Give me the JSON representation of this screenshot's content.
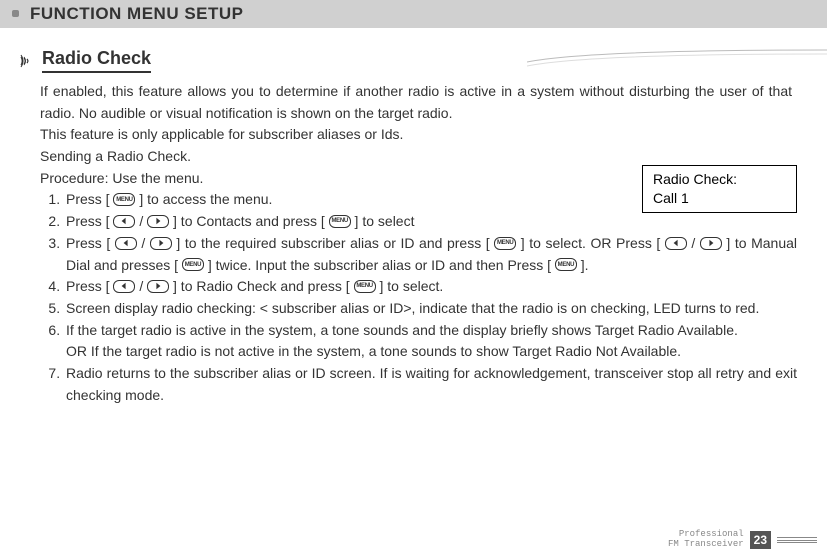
{
  "header": {
    "title": "FUNCTION MENU SETUP"
  },
  "section": {
    "subtitle": "Radio Check",
    "intro1": "If enabled, this feature allows you to determine if another radio is active in a system without disturbing the user of that radio. No audible or visual notification is shown on the target radio.",
    "intro2": "This feature is only applicable for subscriber aliases or Ids.",
    "intro3": "Sending a Radio Check.",
    "intro4": "Procedure: Use the menu."
  },
  "steps": {
    "s1a": "Press [ ",
    "s1b": " ] to access the menu.",
    "s2a": "Press [ ",
    "s2b": " / ",
    "s2c": " ] to Contacts and press [ ",
    "s2d": " ] to select",
    "s3a": "Press [ ",
    "s3b": " / ",
    "s3c": " ] to the required subscriber alias or ID and press [ ",
    "s3d": " ] to select. OR Press  [ ",
    "s3e": " / ",
    "s3f": " ]  to Manual Dial and presses [ ",
    "s3g": " ] twice. Input the subscriber alias or ID and then Press [ ",
    "s3h": " ].",
    "s4a": "Press [ ",
    "s4b": " / ",
    "s4c": " ] to Radio Check and press [ ",
    "s4d": " ] to select.",
    "s5": "Screen display radio checking: < subscriber alias or ID>, indicate that the radio is on checking, LED turns to red.",
    "s6a": "If the target radio is active in the system, a tone sounds and the display briefly shows Target Radio Available.",
    "s6b": "OR If the target radio is not active in the system, a tone sounds to show Target Radio Not Available.",
    "s7": "Radio returns to the subscriber alias or ID screen. If is waiting for acknowledgement, transceiver stop all retry and exit checking mode."
  },
  "callout": {
    "line1": "Radio Check:",
    "line2": "Call 1"
  },
  "buttons": {
    "menu": "MENU"
  },
  "footer": {
    "line1": "Professional",
    "line2": "FM Transceiver",
    "page": "23"
  }
}
